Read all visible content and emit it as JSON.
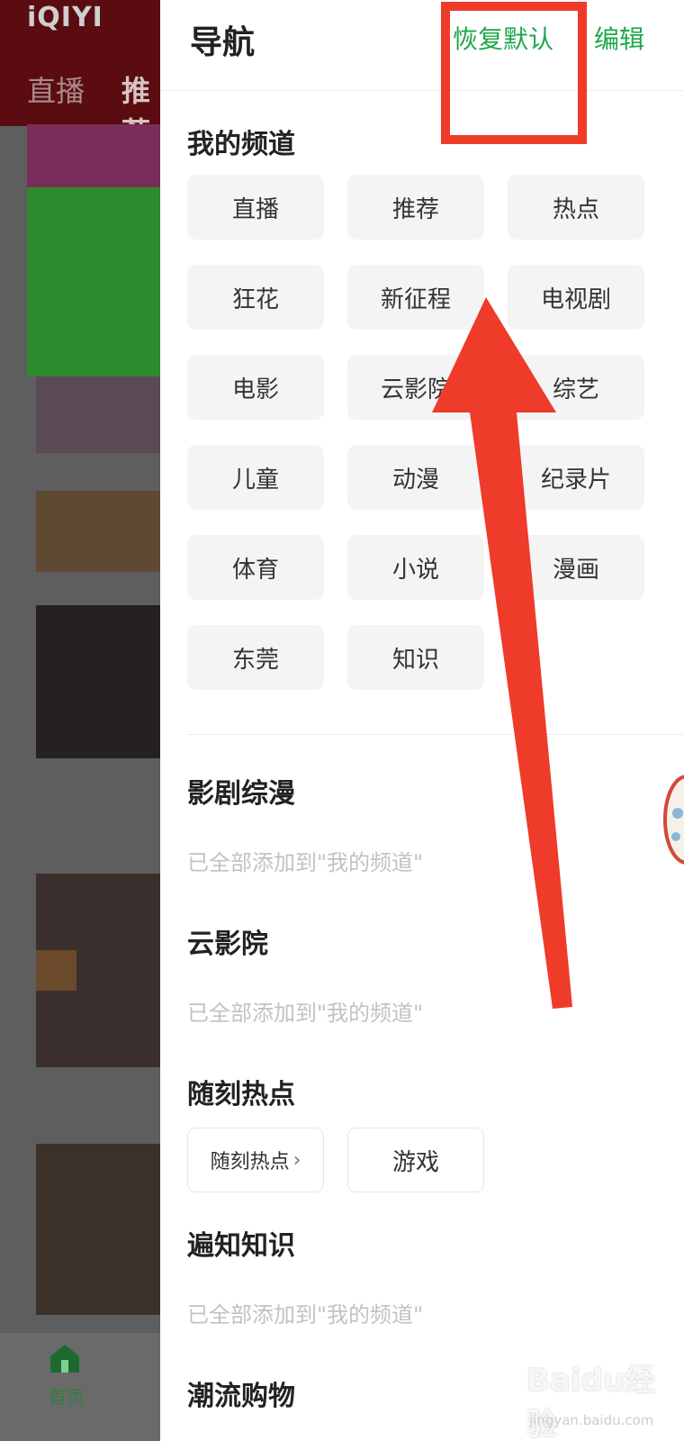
{
  "background_app": {
    "logo": "iQIYI",
    "tabs": [
      "直播",
      "推荐"
    ],
    "bottom_nav": {
      "home_label": "首页"
    }
  },
  "drawer": {
    "title": "导航",
    "restore_label": "恢复默认",
    "edit_label": "编辑",
    "my_channels": {
      "title": "我的频道",
      "items": [
        "直播",
        "推荐",
        "热点",
        "狂花",
        "新征程",
        "电视剧",
        "电影",
        "云影院",
        "综艺",
        "儿童",
        "动漫",
        "纪录片",
        "体育",
        "小说",
        "漫画",
        "东莞",
        "知识"
      ]
    },
    "sections": [
      {
        "title": "影剧综漫",
        "hint": "已全部添加到\"我的频道\""
      },
      {
        "title": "云影院",
        "hint": "已全部添加到\"我的频道\""
      },
      {
        "title": "随刻热点",
        "chips": [
          "随刻热点",
          "游戏"
        ]
      },
      {
        "title": "遍知知识",
        "hint": "已全部添加到\"我的频道\""
      },
      {
        "title": "潮流购物"
      }
    ]
  },
  "watermark": {
    "text": "Baidu经验",
    "sub": "jingyan.baidu.com"
  },
  "colors": {
    "accent_green": "#1ea84a",
    "annotation_red": "#ee3b2a",
    "chip_bg": "#f4f4f4"
  }
}
